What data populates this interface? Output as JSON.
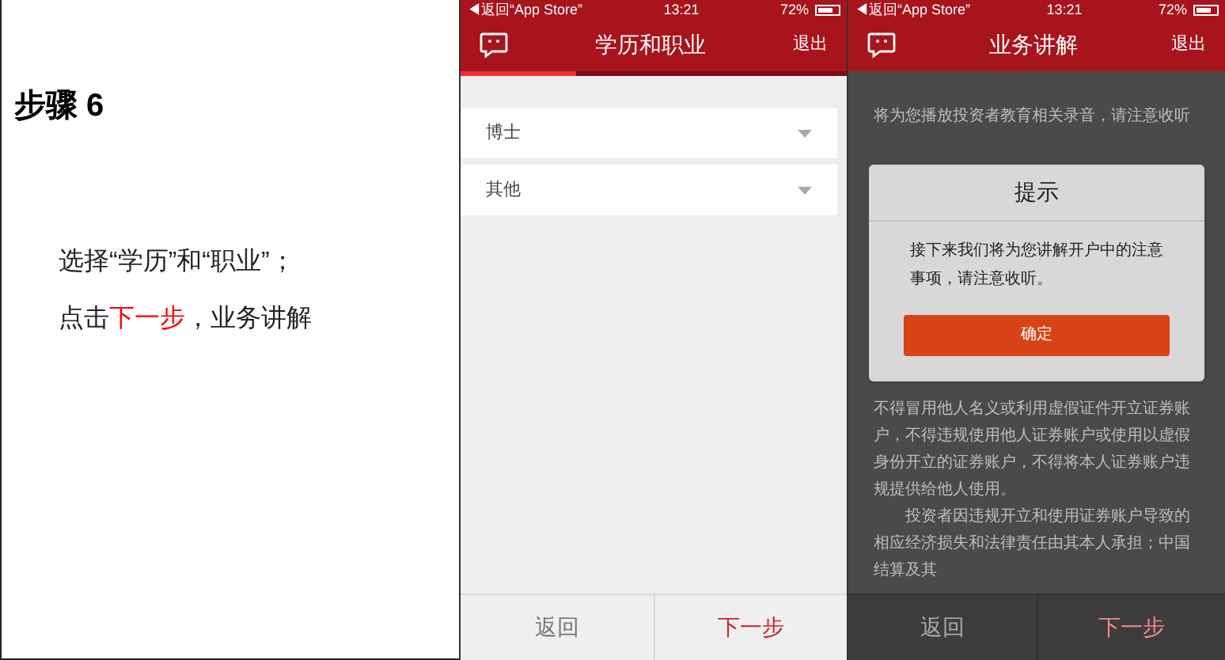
{
  "instruction": {
    "title": "步骤 6",
    "lines": [
      [
        {
          "text": "选择“学历”和“职业”；",
          "highlight": false
        }
      ],
      [
        {
          "text": "点击",
          "highlight": false
        },
        {
          "text": "下一步",
          "highlight": true
        },
        {
          "text": "，业务讲解",
          "highlight": false
        }
      ]
    ]
  },
  "screens": [
    {
      "status_bar": {
        "back": "◀返回“App Store”",
        "time": "13:21",
        "battery": "72%"
      },
      "header": {
        "title": "学历和职业",
        "exit": "退出"
      },
      "progress": {
        "level": 0.3
      },
      "dropdowns": [
        {
          "value": "博士"
        },
        {
          "value": "其他"
        }
      ],
      "footer": {
        "back": "返回",
        "next": "下一步"
      },
      "dimmed": false
    },
    {
      "status_bar": {
        "back": "◀返回“App Store”",
        "time": "13:21",
        "battery": "72%"
      },
      "header": {
        "title": "业务讲解",
        "exit": "退出"
      },
      "intro": "将为您播放投资者教育相关录音，请注意收听",
      "paragraphs": [
        "不得冒用他人名义或利用虚假证件开立证券账户，不得违规使用他人证券账户或使用以虚假身份开立的证券账户，不得将本人证券账户违规提供给他人使用。",
        "投资者因违规开立和使用证券账户导致的相应经济损失和法律责任由其本人承担；中国结算及其"
      ],
      "dialog": {
        "title": "提示",
        "message": "接下来我们将为您讲解开户中的注意事项，请注意收听。",
        "button": "确定"
      },
      "footer": {
        "back": "返回",
        "next": "下一步"
      },
      "dimmed": true
    }
  ]
}
